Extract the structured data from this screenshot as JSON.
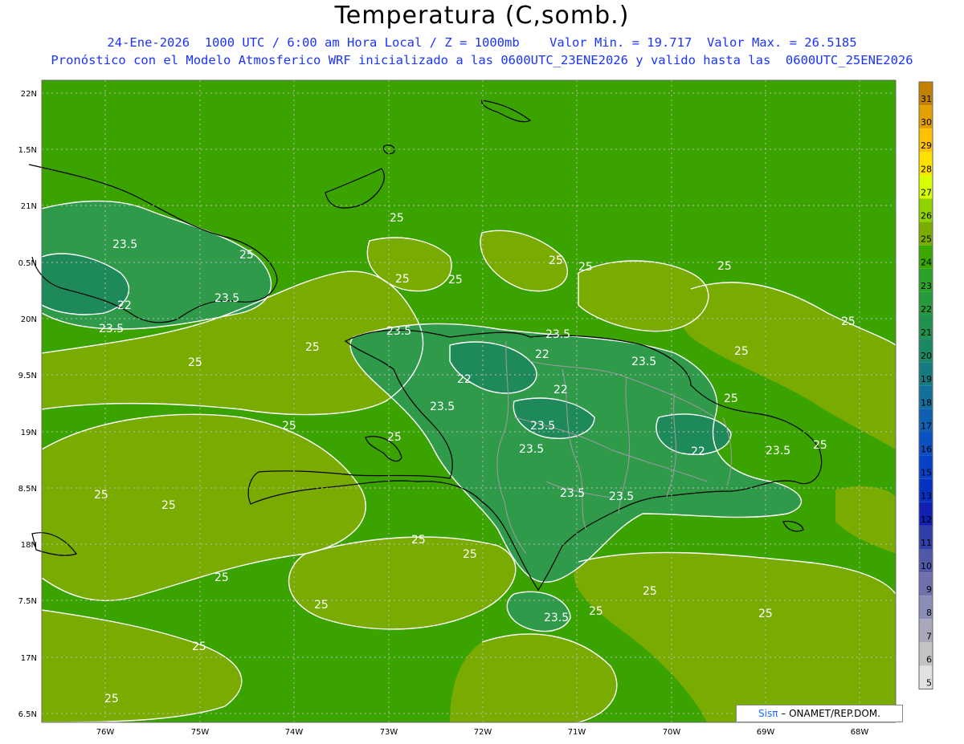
{
  "header": {
    "title": "Temperatura (C,somb.)",
    "line1": "24-Ene-2026  1000 UTC / 6:00 am Hora Local / Z = 1000mb    Valor Min. = 19.717  Valor Max. = 26.5185",
    "line2": "Pronóstico con el Modelo Atmosferico WRF inicializado a las 0600UTC_23ENE2026 y valido hasta las  0600UTC_25ENE2026"
  },
  "axes": {
    "lat_labels": [
      "22N",
      "1.5N",
      "21N",
      "0.5N",
      "20N",
      "9.5N",
      "19N",
      "8.5N",
      "18N",
      "7.5N",
      "17N",
      "6.5N"
    ],
    "lon_labels": [
      "76W",
      "75W",
      "74W",
      "73W",
      "72W",
      "71W",
      "70W",
      "69W",
      "68W"
    ]
  },
  "contour_labels": [
    "25",
    "25",
    "25",
    "25",
    "25",
    "25",
    "25",
    "25",
    "25",
    "25",
    "25",
    "25",
    "25",
    "25",
    "25",
    "25",
    "25",
    "25",
    "25",
    "25",
    "25",
    "25",
    "25",
    "25",
    "25",
    "25",
    "23.5",
    "23.5",
    "23.5",
    "23.5",
    "23.5",
    "23.5",
    "23.5",
    "23.5",
    "23.5",
    "23.5",
    "23.5",
    "23.5",
    "23.5",
    "22",
    "22",
    "22",
    "22",
    "22"
  ],
  "legend": {
    "values": [
      "31",
      "30",
      "29",
      "28",
      "27",
      "26",
      "25",
      "24",
      "23",
      "22",
      "21",
      "20",
      "19",
      "18",
      "17",
      "16",
      "15",
      "13",
      "12",
      "11",
      "10",
      "9",
      "8",
      "7",
      "6",
      "5"
    ],
    "colors": [
      "#c28200",
      "#e3a000",
      "#ffc000",
      "#ffe100",
      "#d9ff00",
      "#8ed200",
      "#7aad00",
      "#3aa800",
      "#2ea228",
      "#269a3c",
      "#1f9250",
      "#1a8866",
      "#167a80",
      "#14709a",
      "#1060b2",
      "#0c50c2",
      "#0840c8",
      "#0630c0",
      "#1020b0",
      "#3040a8",
      "#5058a8",
      "#7070ac",
      "#8c8cb8",
      "#a8a8b8",
      "#c4c4c4",
      "#e2e2e2"
    ]
  },
  "credit": {
    "brand": "Sisπ",
    "text": "– ONAMET/REP.DOM."
  },
  "colors": {
    "ocean": "#3aa300",
    "warm": "#7aab00",
    "cool": "#2e9a4a",
    "coolest": "#1e8a5a",
    "subtitle": "#1a33ff"
  }
}
